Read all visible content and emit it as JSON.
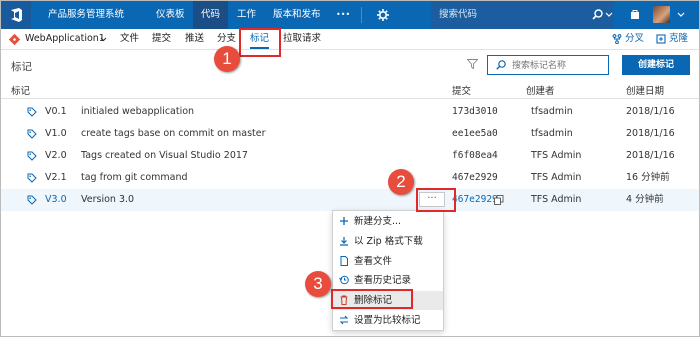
{
  "topnav": {
    "project": "产品服务管理系统",
    "items": [
      "仪表板",
      "代码",
      "工作",
      "版本和发布",
      "•••"
    ],
    "search_placeholder": "搜索代码",
    "colors": {
      "bar": "#0a67b3",
      "active": "#1b4e86"
    }
  },
  "subnav": {
    "repo": "WebApplication1",
    "items": [
      "文件",
      "提交",
      "推送",
      "分支",
      "标记",
      "拉取请求"
    ],
    "fork": "分叉",
    "clone": "克隆"
  },
  "page": {
    "title": "标记",
    "search_placeholder": "搜索标记名称",
    "create_button": "创建标记"
  },
  "table": {
    "headers": [
      "标记",
      "提交",
      "创建者",
      "创建日期"
    ],
    "rows": [
      {
        "tag": "V0.1",
        "message": "initialed webapplication",
        "commit": "173d3010",
        "author": "tfsadmin",
        "date": "2018/1/16"
      },
      {
        "tag": "V1.0",
        "message": "create tags base on commit on master",
        "commit": "ee1ee5a0",
        "author": "tfsadmin",
        "date": "2018/1/16"
      },
      {
        "tag": "V2.0",
        "message": "Tags created on Visual Studio 2017",
        "commit": "f6f08ea4",
        "author": "TFS Admin",
        "date": "2018/1/16"
      },
      {
        "tag": "V2.1",
        "message": "tag from git command",
        "commit": "467e2929",
        "author": "TFS Admin",
        "date": "16 分钟前"
      },
      {
        "tag": "V3.0",
        "message": "Version 3.0",
        "commit": "467e2929",
        "author": "TFS Admin",
        "date": "4 分钟前"
      }
    ]
  },
  "more_button": "···",
  "context_menu": {
    "items": [
      {
        "label": "新建分支...",
        "icon": "plus-icon"
      },
      {
        "label": "以 Zip 格式下载",
        "icon": "download-icon"
      },
      {
        "label": "查看文件",
        "icon": "file-icon"
      },
      {
        "label": "查看历史记录",
        "icon": "history-icon"
      },
      {
        "label": "删除标记",
        "icon": "trash-icon"
      },
      {
        "label": "设置为比较标记",
        "icon": "compare-icon"
      }
    ]
  },
  "callouts": [
    "1",
    "2",
    "3"
  ],
  "annotation_color": "#e02a2a"
}
